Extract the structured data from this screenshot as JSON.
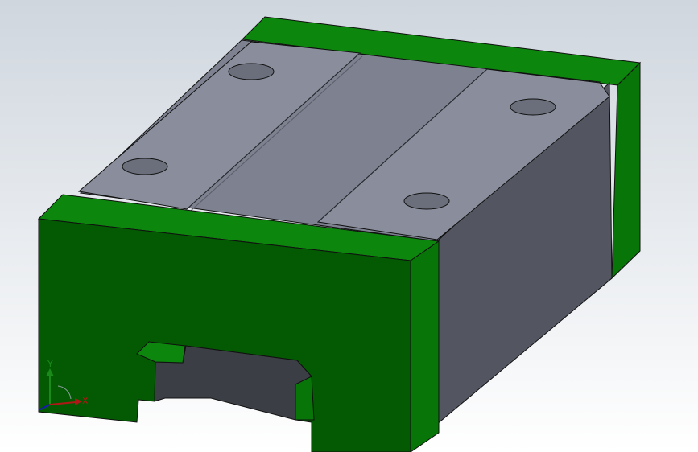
{
  "viewport": {
    "background_top": "#cfd6de",
    "background_bottom": "#ffffff"
  },
  "part": {
    "name": "linear-guide-carriage-block",
    "colors": {
      "end_seal_front": "#035a03",
      "end_seal_top": "#0c860c",
      "end_seal_side": "#087508",
      "end_seal_back": "#0c860c",
      "body_top": "#7d8190",
      "body_side": "#535661",
      "body_plate": "#8a8e9c",
      "bore_hole": "#6b6f7b",
      "recess_shadow": "#3c3e46",
      "edge": "#111111"
    }
  },
  "triad": {
    "x_label": "X",
    "y_label": "Y",
    "x_color": "#b01818",
    "y_color": "#1a8a1a",
    "z_color": "#1a1ab0"
  }
}
